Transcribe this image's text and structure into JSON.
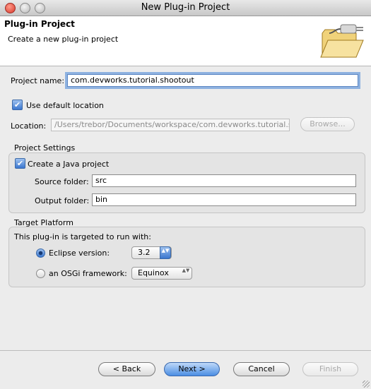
{
  "window": {
    "title": "New Plug-in Project"
  },
  "header": {
    "title": "Plug-in Project",
    "subtitle": "Create a new plug-in project"
  },
  "project": {
    "name_label": "Project name:",
    "name_value": "com.devworks.tutorial.shootout",
    "use_default_location_label": "Use default location",
    "use_default_location_checked": true,
    "location_label": "Location:",
    "location_value": "/Users/trebor/Documents/workspace/com.devworks.tutorial.s",
    "browse_label": "Browse..."
  },
  "project_settings": {
    "group_title": "Project Settings",
    "create_java_label": "Create a Java project",
    "create_java_checked": true,
    "source_folder_label": "Source folder:",
    "source_folder_value": "src",
    "output_folder_label": "Output folder:",
    "output_folder_value": "bin"
  },
  "target_platform": {
    "group_title": "Target Platform",
    "intro": "This plug-in is targeted to run with:",
    "eclipse_label": "Eclipse version:",
    "eclipse_selected": true,
    "eclipse_version": "3.2",
    "osgi_label": "an OSGi framework:",
    "osgi_selected": false,
    "osgi_framework": "Equinox"
  },
  "footer": {
    "back_label": "< Back",
    "next_label": "Next >",
    "cancel_label": "Cancel",
    "finish_label": "Finish"
  },
  "icons": {
    "checkmark": "✔",
    "updown_arrows": "▲▼",
    "wizard_image": "folder-plug-icon"
  }
}
